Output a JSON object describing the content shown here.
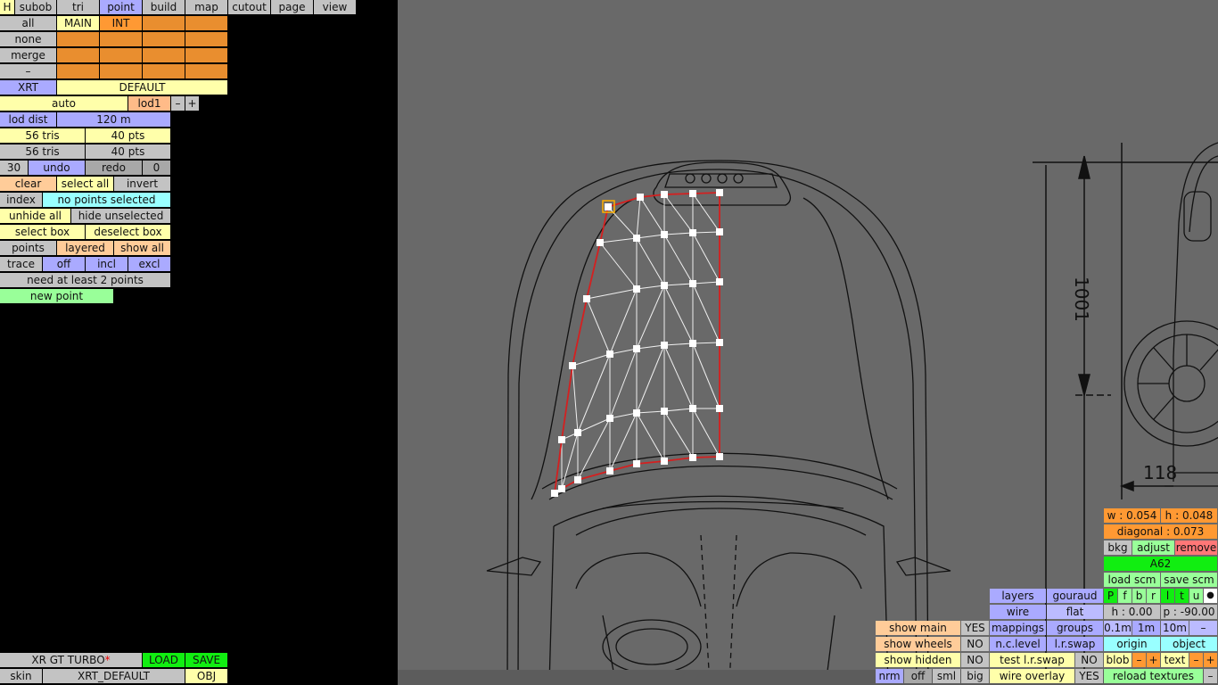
{
  "tabs": {
    "h": "H",
    "subob": "subob",
    "tri": "tri",
    "point": "point",
    "build": "build",
    "map": "map",
    "cutout": "cutout",
    "page": "page",
    "view": "view"
  },
  "selection": {
    "all": "all",
    "none": "none",
    "merge": "merge",
    "dash": "–",
    "main": "MAIN",
    "int": "INT"
  },
  "config": {
    "xrt": "XRT",
    "default": "DEFAULT",
    "auto": "auto",
    "lod1": "lod1",
    "minus": "–",
    "plus": "+"
  },
  "lod": {
    "label": "lod dist",
    "value": "120 m"
  },
  "stats": {
    "tris1": "56 tris",
    "pts1": "40 pts",
    "tris2": "56 tris",
    "pts2": "40 pts"
  },
  "history": {
    "count": "30",
    "undo": "undo",
    "redo": "redo",
    "redo_count": "0"
  },
  "point_tools": {
    "clear": "clear",
    "select_all": "select all",
    "invert": "invert",
    "index": "index",
    "index_status": "no points selected",
    "unhide_all": "unhide all",
    "hide_unselected": "hide unselected",
    "select_box": "select box",
    "deselect_box": "deselect box",
    "points": "points",
    "layered": "layered",
    "show_all": "show all",
    "trace": "trace",
    "off": "off",
    "incl": "incl",
    "excl": "excl",
    "need_points": "need at least 2 points",
    "new_point": "new point"
  },
  "file": {
    "name": "XR GT TURBO",
    "modified": "*",
    "load": "LOAD",
    "save": "SAVE",
    "skin": "skin",
    "skin_name": "XRT_DEFAULT",
    "obj": "OBJ"
  },
  "bg_panel": {
    "w": "w : 0.054",
    "h": "h : 0.048",
    "diagonal": "diagonal : 0.073",
    "bkg": "bkg",
    "adjust": "adjust",
    "remove": "remove",
    "image": "A62",
    "load_scm": "load scm",
    "save_scm": "save scm",
    "views": [
      "P",
      "f",
      "b",
      "r",
      "l",
      "t",
      "u"
    ],
    "dot": "●",
    "height": "h : 0.00",
    "pitch": "p : -90.00",
    "grid": [
      "0.1m",
      "1m",
      "10m"
    ],
    "grid_minus": "–",
    "origin": "origin",
    "object": "object",
    "blob": "blob",
    "text": "text",
    "minus": "–",
    "plus": "+"
  },
  "render": {
    "layers": "layers",
    "gouraud": "gouraud",
    "wire": "wire",
    "flat": "flat",
    "mappings": "mappings",
    "groups": "groups",
    "nc_level": "n.c.level",
    "lr_swap": "l.r.swap",
    "test_lr_swap": "test l.r.swap",
    "test_value": "NO",
    "wire_overlay": "wire overlay",
    "overlay_value": "YES",
    "reload_textures": "reload textures",
    "reload_minus": "–",
    "nrm": "nrm",
    "off": "off",
    "sml": "sml",
    "big": "big"
  },
  "show": {
    "main": "show main",
    "main_value": "YES",
    "wheels": "show wheels",
    "wheels_value": "NO",
    "hidden": "show hidden",
    "hidden_value": "NO"
  },
  "blueprint": {
    "dim_height": "1001",
    "dim_width": "118"
  }
}
